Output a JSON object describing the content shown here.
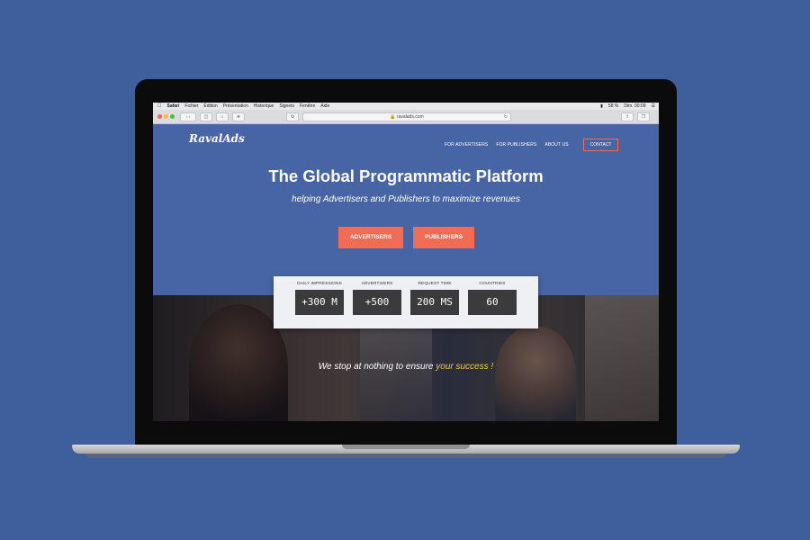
{
  "menubar": {
    "items": [
      "Safari",
      "Fichier",
      "Édition",
      "Présentation",
      "Historique",
      "Signets",
      "Fenêtre",
      "Aide"
    ],
    "battery": "58 %",
    "clock": "Dim. 00:09"
  },
  "browser": {
    "url": "ravalads.com"
  },
  "site": {
    "logo": "RavalAds",
    "nav": [
      "FOR ADVERTISERS",
      "FOR PUBLISHERS",
      "ABOUT US"
    ],
    "contact": "CONTACT",
    "hero_title": "The Global Programmatic Platform",
    "hero_sub": "helping Advertisers and Publishers to maximize revenues",
    "buttons": [
      "ADVERTISERS",
      "PUBLISHERS"
    ],
    "stats": [
      {
        "label": "DAILY IMPRESSIONS",
        "value": "+300 M"
      },
      {
        "label": "ADVERTISERS",
        "value": "+500"
      },
      {
        "label": "REQUEST TIME",
        "value": "200 MS"
      },
      {
        "label": "COUNTRIES",
        "value": "60"
      }
    ],
    "tagline_a": "We stop at nothing to ensure ",
    "tagline_b": "your success !"
  },
  "colors": {
    "background": "#3f5e9c",
    "site_bg": "#4765a5",
    "accent": "#f26b55"
  }
}
